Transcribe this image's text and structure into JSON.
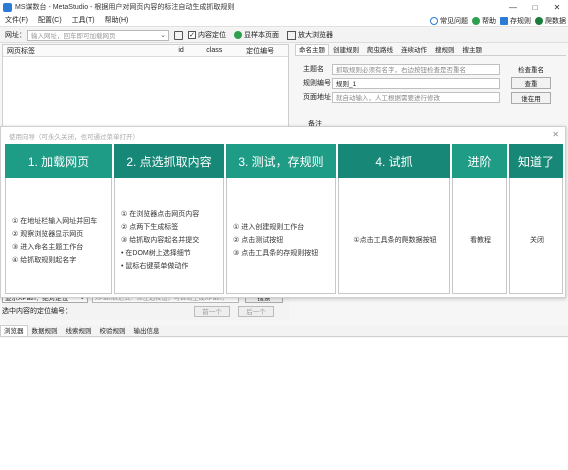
{
  "titlebar": {
    "title": "MS谋数台 - MetaStudio - 根据用户对网页内容的标注自动生成抓取规则",
    "min": "—",
    "max": "□",
    "close": "✕"
  },
  "menu": {
    "items": [
      "文件(F)",
      "配置(C)",
      "工具(T)",
      "帮助(H)"
    ],
    "right": [
      "常见问题",
      "帮助",
      "存规则",
      "爬数据"
    ]
  },
  "address": {
    "label": "网址：",
    "placeholder": "输入网址，回车即可加载网页",
    "content_locate": "内容定位",
    "sample_page": "显样本页面",
    "zoom_browser": "放大浏览器"
  },
  "left": {
    "columns": [
      "网页标签",
      "id",
      "class",
      "定位编号"
    ]
  },
  "right": {
    "tabs": [
      "命名主题",
      "创建规则",
      "爬虫路线",
      "连续动作",
      "搜规则",
      "搜主题"
    ],
    "form": {
      "theme_label": "主题名",
      "theme_placeholder": "抓取规则必须有名字，右边按钮检查是否重名",
      "rule_label": "规则编号",
      "rule_value": "规则_1",
      "page_label": "页面地址",
      "page_placeholder": "就自动输入，人工根据需要进行修改"
    },
    "check_title": "检查重名",
    "check_btn": "查重",
    "use_btn": "谁在用",
    "remark": "备注"
  },
  "wizard": {
    "hint": "使用向导（可永久关闭，也可通过菜单打开）",
    "close": "✕",
    "steps": [
      {
        "title": "1. 加载网页",
        "lines": [
          "① 在地址栏输入网址并回车",
          "② 观察浏览器显示网页",
          "③ 进入命名主题工作台",
          "④ 给抓取规则起名字"
        ]
      },
      {
        "title": "2. 点选抓取内容",
        "lines": [
          "① 在浏览器点击网页内容",
          "② 点两下生成标签",
          "③ 给抓取内容起名并提交",
          "• 在DOM树上选择细节",
          "• 鼠标右键菜单做动作"
        ]
      },
      {
        "title": "3. 测试，存规则",
        "lines": [
          "① 进入创建规则工作台",
          "② 点击测试按钮",
          "③ 点击工具条的存规则按钮"
        ]
      },
      {
        "title": "4. 试抓",
        "lines": [
          "①点击工具条的爬数据按钮"
        ]
      },
      {
        "title": "进阶",
        "lines": [
          "看教程"
        ]
      },
      {
        "title": "知道了",
        "lines": [
          "关闭"
        ]
      }
    ]
  },
  "xpath": {
    "select": "显示XPath：绝对定位",
    "input_placeholder": "XPath表达式：点左边按钮，可自动生成XPath；",
    "search": "搜索",
    "selected_label": "选中内容的定位编号：",
    "prev": "前一个",
    "next": "后一个"
  },
  "bottom_tabs": [
    "浏览器",
    "数据规则",
    "线索规则",
    "校验规则",
    "输出信息"
  ],
  "colors": {
    "accent": "#1e9c86",
    "accent_dark": "#178877",
    "help_green": "#2e9e4f",
    "crawl_green": "#1a7d3a"
  }
}
